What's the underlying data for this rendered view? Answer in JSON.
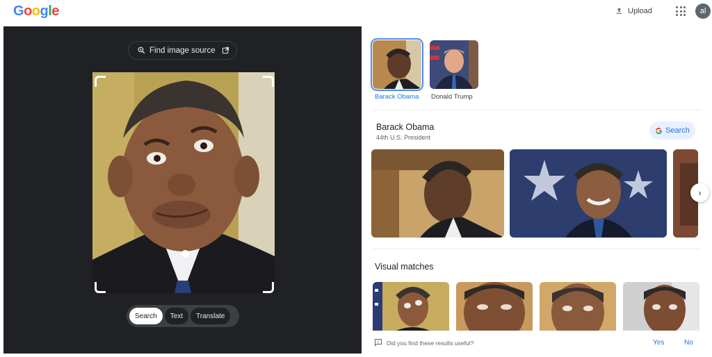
{
  "header": {
    "logo_letters": [
      {
        "ch": "G",
        "color": "#4285f4"
      },
      {
        "ch": "o",
        "color": "#ea4335"
      },
      {
        "ch": "o",
        "color": "#fbbc05"
      },
      {
        "ch": "g",
        "color": "#4285f4"
      },
      {
        "ch": "l",
        "color": "#34a853"
      },
      {
        "ch": "e",
        "color": "#ea4335"
      }
    ],
    "upload_label": "Upload",
    "upload_icon": "upload-icon",
    "apps_icon": "apps-grid-icon",
    "avatar_initials": "al"
  },
  "lens": {
    "find_source_label": "Find image source",
    "modes": [
      {
        "label": "Search",
        "active": true
      },
      {
        "label": "Text",
        "active": false
      },
      {
        "label": "Translate",
        "active": false
      }
    ]
  },
  "results": {
    "people": [
      {
        "label": "Barack Obama",
        "selected": true
      },
      {
        "label": "Donald Trump",
        "selected": false
      }
    ],
    "entity": {
      "name": "Barack Obama",
      "description": "44th U.S. President",
      "search_label": "Search"
    },
    "visual_matches_title": "Visual matches",
    "feedback": {
      "question": "Did you find these results useful?",
      "yes": "Yes",
      "no": "No"
    }
  },
  "colors": {
    "accent": "#1a73e8",
    "lens_bg": "#202124"
  }
}
